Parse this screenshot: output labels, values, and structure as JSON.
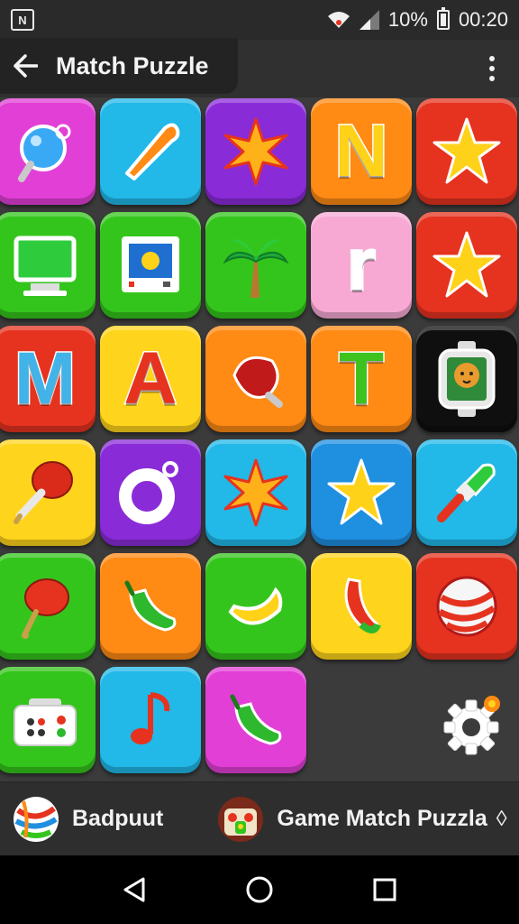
{
  "status_bar": {
    "app_icon_label": "N",
    "wifi_icon": "wifi-icon",
    "signal_icon": "signal-icon",
    "battery_percent": "10%",
    "battery_icon": "battery-icon",
    "time": "00:20"
  },
  "app_bar": {
    "back_icon": "arrow-left-icon",
    "title": "Match Puzzle",
    "overflow_icon": "more-vert-icon"
  },
  "tiles": [
    {
      "name": "tile-balloon",
      "color": "#e23fd6",
      "icon": "balloon-icon"
    },
    {
      "name": "tile-boomerang",
      "color": "#22b8e8",
      "icon": "boomerang-icon"
    },
    {
      "name": "tile-star-burst",
      "color": "#8a2bd8",
      "icon": "starburst-icon"
    },
    {
      "name": "tile-letter-n",
      "color": "#ff8a14",
      "letter": "N",
      "letter_color": "#ffd21a"
    },
    {
      "name": "tile-blue-star",
      "color": "#e5331f",
      "icon": "star-icon"
    },
    {
      "name": "tile-monitor",
      "color": "#34c51c",
      "icon": "monitor-icon"
    },
    {
      "name": "tile-photo-frame",
      "color": "#34c51c",
      "icon": "photo-frame-icon"
    },
    {
      "name": "tile-palm-tree",
      "color": "#34c51c",
      "icon": "palm-tree-icon"
    },
    {
      "name": "tile-letter-r",
      "color": "#f7a9d4",
      "letter": "r",
      "letter_color": "#ffffff"
    },
    {
      "name": "tile-yellow-star",
      "color": "#e5331f",
      "icon": "star-icon"
    },
    {
      "name": "tile-letter-m",
      "color": "#e5331f",
      "letter": "M",
      "letter_color": "#42b3e8"
    },
    {
      "name": "tile-letter-a",
      "color": "#ffd41c",
      "letter": "A",
      "letter_color": "#e5331f"
    },
    {
      "name": "tile-seed",
      "color": "#ff8a14",
      "icon": "seed-icon"
    },
    {
      "name": "tile-letter-t",
      "color": "#ff8a14",
      "letter": "T",
      "letter_color": "#3ec21e"
    },
    {
      "name": "tile-tiger-watch",
      "color": "#0f0f0f",
      "icon": "tiger-watch-icon"
    },
    {
      "name": "tile-lantern-pin",
      "color": "#ffd41c",
      "icon": "pin-icon"
    },
    {
      "name": "tile-ring",
      "color": "#8a2bd8",
      "icon": "ring-icon"
    },
    {
      "name": "tile-orange-burst",
      "color": "#22b8e8",
      "icon": "starburst-icon"
    },
    {
      "name": "tile-gold-star",
      "color": "#1f8fe0",
      "icon": "star-icon"
    },
    {
      "name": "tile-paint-brush",
      "color": "#22b8e8",
      "icon": "paint-brush-icon"
    },
    {
      "name": "tile-lantern",
      "color": "#34c51c",
      "icon": "lantern-icon"
    },
    {
      "name": "tile-pepper",
      "color": "#ff8a14",
      "icon": "pepper-icon"
    },
    {
      "name": "tile-banana",
      "color": "#34c51c",
      "icon": "banana-icon"
    },
    {
      "name": "tile-chili",
      "color": "#ffd41c",
      "icon": "chili-icon"
    },
    {
      "name": "tile-candy-ball",
      "color": "#e5331f",
      "icon": "candy-ball-icon"
    },
    {
      "name": "tile-game-controller",
      "color": "#34c51c",
      "icon": "gamepad-icon"
    },
    {
      "name": "tile-music-note",
      "color": "#22b8e8",
      "icon": "music-note-icon"
    },
    {
      "name": "tile-banana-pepper",
      "color": "#e23fd6",
      "icon": "pepper-icon"
    }
  ],
  "settings_icon": "gear-icon",
  "footer": {
    "item1_label": "Badpuut",
    "item1_icon": "candy-ball-avatar",
    "item2_label": "Game Match Puzzla",
    "item2_icon": "game-avatar",
    "item2_chevron": "◊"
  },
  "nav_bar": {
    "back_icon": "nav-back-icon",
    "home_icon": "nav-home-icon",
    "recents_icon": "nav-recents-icon"
  }
}
